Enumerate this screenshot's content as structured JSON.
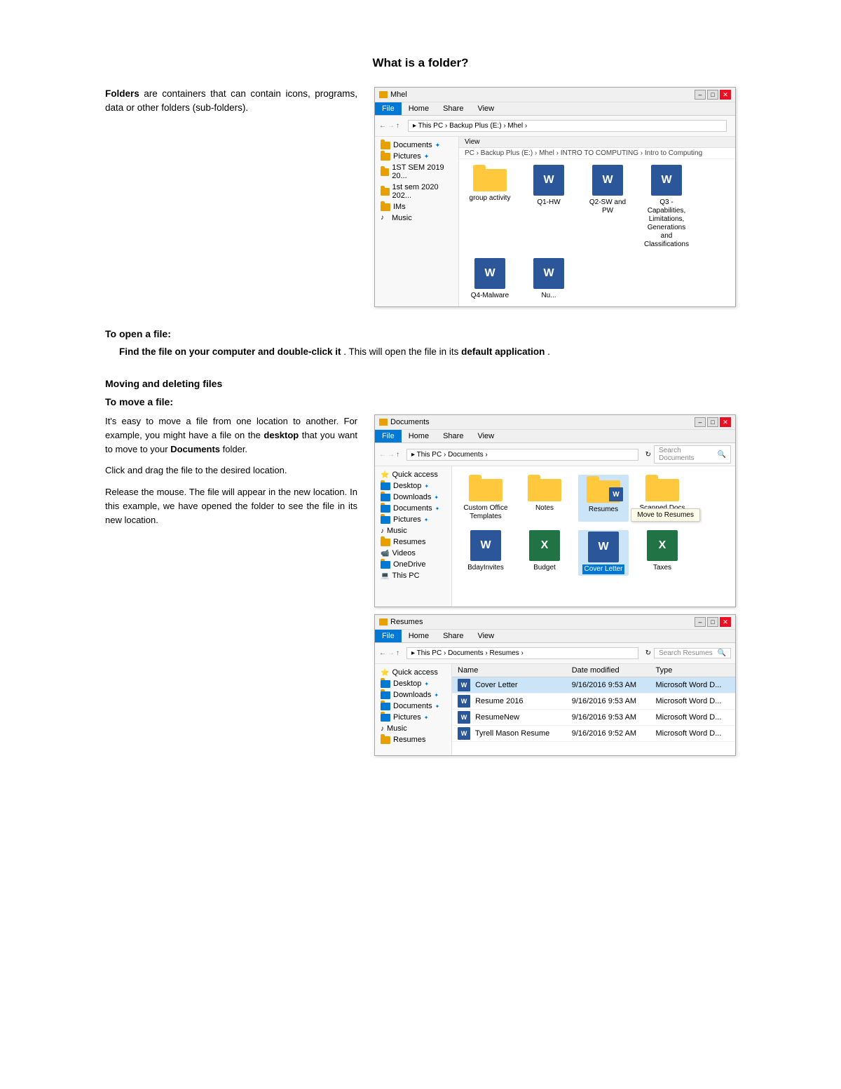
{
  "page": {
    "title": "What is a folder?",
    "sections": [
      {
        "id": "folders-intro",
        "text": "Folders are containers that can contain icons, programs, data or other folders (sub-folders).",
        "bold_word": "Folders"
      },
      {
        "id": "open-file",
        "heading": "To open a file:",
        "subheading": "Find the file on your computer and double-click it",
        "subtext": ". This will open the file in its ",
        "bold_end": "default application",
        "period": "."
      },
      {
        "id": "moving-deleting",
        "heading": "Moving and deleting files"
      },
      {
        "id": "move-file",
        "heading": "To move a file:",
        "para1": "It's easy to move a file from one location to another. For example, you might have a file on the desktop that you want to move to your Documents folder.",
        "para1_bold1": "desktop",
        "para1_bold2": "Documents",
        "para2": "Click and drag the file to the desired location.",
        "para3": "Release the mouse. The file will appear in the new location. In this example, we have opened the folder to see the file in its new location."
      }
    ]
  },
  "explorer1": {
    "title": "Mhel",
    "tabs": [
      "File",
      "Home",
      "Share",
      "View"
    ],
    "active_tab": "File",
    "breadcrumb": [
      "This PC",
      "Backup Plus (E:)",
      "Mhel"
    ],
    "sidebar_items": [
      "Documents",
      "Pictures",
      "1ST SEM 2019 20...",
      "1st sem 2020 202...",
      "IMs",
      "Music"
    ],
    "view_label": "View",
    "inner_breadcrumb": [
      "PC",
      "Backup Plus (E:)",
      "Mhel",
      "INTRO TO COMPUTING",
      "Intro to Computing"
    ],
    "files": [
      {
        "name": "group activity",
        "type": "folder"
      },
      {
        "name": "Q1-HW",
        "type": "word"
      },
      {
        "name": "Q2-SW and PW",
        "type": "word"
      },
      {
        "name": "Q3 - Capabilities, Limitations, Generations and Classifications",
        "type": "word"
      },
      {
        "name": "Q4-Malware",
        "type": "word"
      },
      {
        "name": "Nu...",
        "type": "word"
      }
    ]
  },
  "explorer2": {
    "title": "Documents",
    "tabs": [
      "File",
      "Home",
      "Share",
      "View"
    ],
    "active_tab": "File",
    "breadcrumb": [
      "This PC",
      "Documents"
    ],
    "search_placeholder": "Search Documents",
    "sidebar_items": [
      "Quick access",
      "Desktop",
      "Downloads",
      "Documents",
      "Pictures",
      "Music",
      "Resumes",
      "Videos",
      "OneDrive",
      "This PC"
    ],
    "files": [
      {
        "name": "Custom Office\nTemplates",
        "type": "folder"
      },
      {
        "name": "Notes",
        "type": "folder"
      },
      {
        "name": "Resumes",
        "type": "folder",
        "selected": true
      },
      {
        "name": "Scanned Docs",
        "type": "folder"
      },
      {
        "name": "BdayInvites",
        "type": "word"
      },
      {
        "name": "Budget",
        "type": "excel"
      },
      {
        "name": "Cover Letter",
        "type": "word",
        "highlighted": true
      },
      {
        "name": "Taxes",
        "type": "excel"
      }
    ],
    "tooltip": "Move to Resumes"
  },
  "explorer3": {
    "title": "Resumes",
    "tabs": [
      "File",
      "Home",
      "Share",
      "View"
    ],
    "active_tab": "File",
    "breadcrumb": [
      "This PC",
      "Documents",
      "Resumes"
    ],
    "search_placeholder": "Search Resumes",
    "sidebar_items": [
      "Quick access",
      "Desktop",
      "Downloads",
      "Documents",
      "Pictures",
      "Music",
      "Resumes"
    ],
    "columns": [
      "Name",
      "Date modified",
      "Type"
    ],
    "files": [
      {
        "name": "Cover Letter",
        "date": "9/16/2016 9:53 AM",
        "type": "Microsoft Word D...",
        "selected": true
      },
      {
        "name": "Resume 2016",
        "date": "9/16/2016 9:53 AM",
        "type": "Microsoft Word D..."
      },
      {
        "name": "ResumeNew",
        "date": "9/16/2016 9:53 AM",
        "type": "Microsoft Word D..."
      },
      {
        "name": "Tyrell Mason Resume",
        "date": "9/16/2016 9:52 AM",
        "type": "Microsoft Word D..."
      }
    ]
  },
  "icons": {
    "folder": "📁",
    "word": "W",
    "excel": "X",
    "back_arrow": "←",
    "forward_arrow": "→",
    "up_arrow": "↑",
    "search": "🔍",
    "minimize": "–",
    "maximize": "□",
    "close": "✕",
    "chevron": "›"
  }
}
